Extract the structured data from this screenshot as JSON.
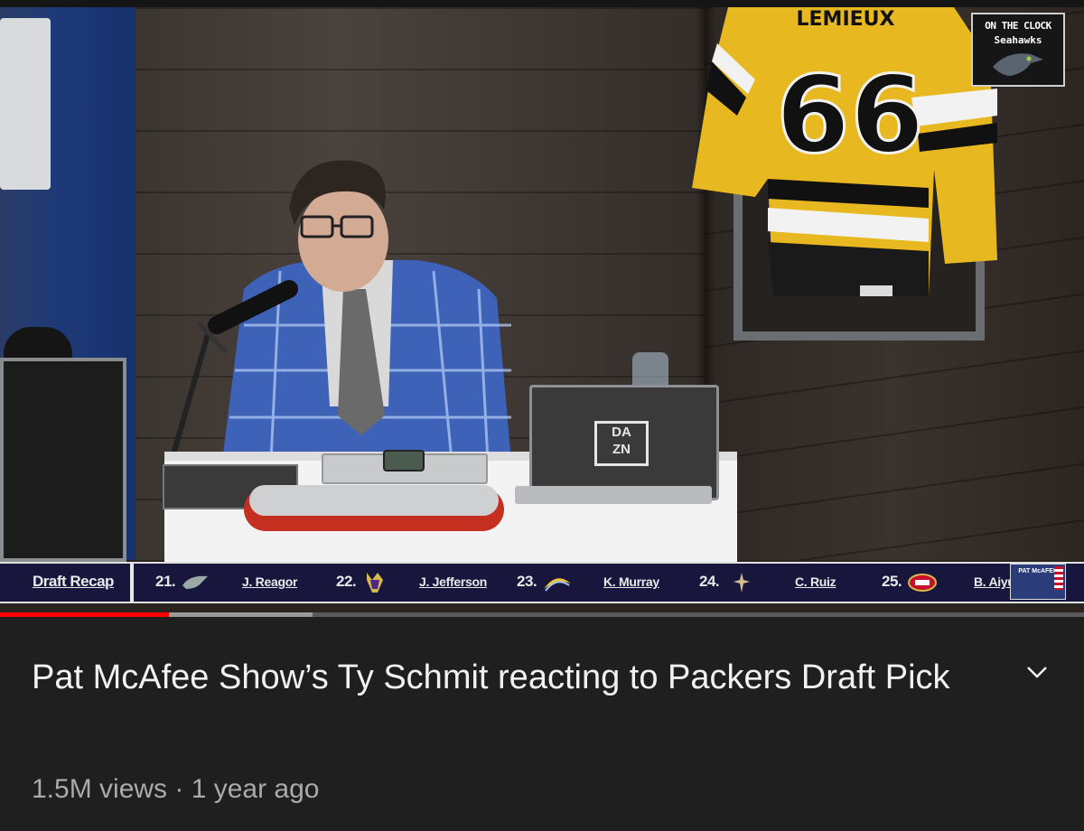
{
  "video": {
    "channel_bug": {
      "line1": "ON THE CLOCK",
      "line2": "Seahawks"
    },
    "jersey_number": "66",
    "jersey_name": "LEMIEUX",
    "laptop_brand": "DAZN",
    "ticker": {
      "label": "Draft Recap",
      "picks": [
        {
          "number": "21.",
          "team_icon": "eagles-logo-icon",
          "player": "J. Reagor"
        },
        {
          "number": "22.",
          "team_icon": "vikings-logo-icon",
          "player": "J. Jefferson"
        },
        {
          "number": "23.",
          "team_icon": "chargers-logo-icon",
          "player": "K. Murray"
        },
        {
          "number": "24.",
          "team_icon": "saints-logo-icon",
          "player": "C. Ruiz"
        },
        {
          "number": "25.",
          "team_icon": "49ers-logo-icon",
          "player": "B. Aiyu"
        }
      ],
      "badge_text": "PAT McAFEE"
    },
    "progress": {
      "played_fraction": 0.156,
      "buffered_fraction": 0.288
    },
    "colors": {
      "progress_played": "#ff0000",
      "ticker_bg": "#19163e"
    }
  },
  "info": {
    "title": "Pat McAfee Show’s Ty Schmit reacting to Packers Draft Pick",
    "meta": "1.5M views · 1 year ago",
    "expand_icon": "chevron-down-icon"
  }
}
